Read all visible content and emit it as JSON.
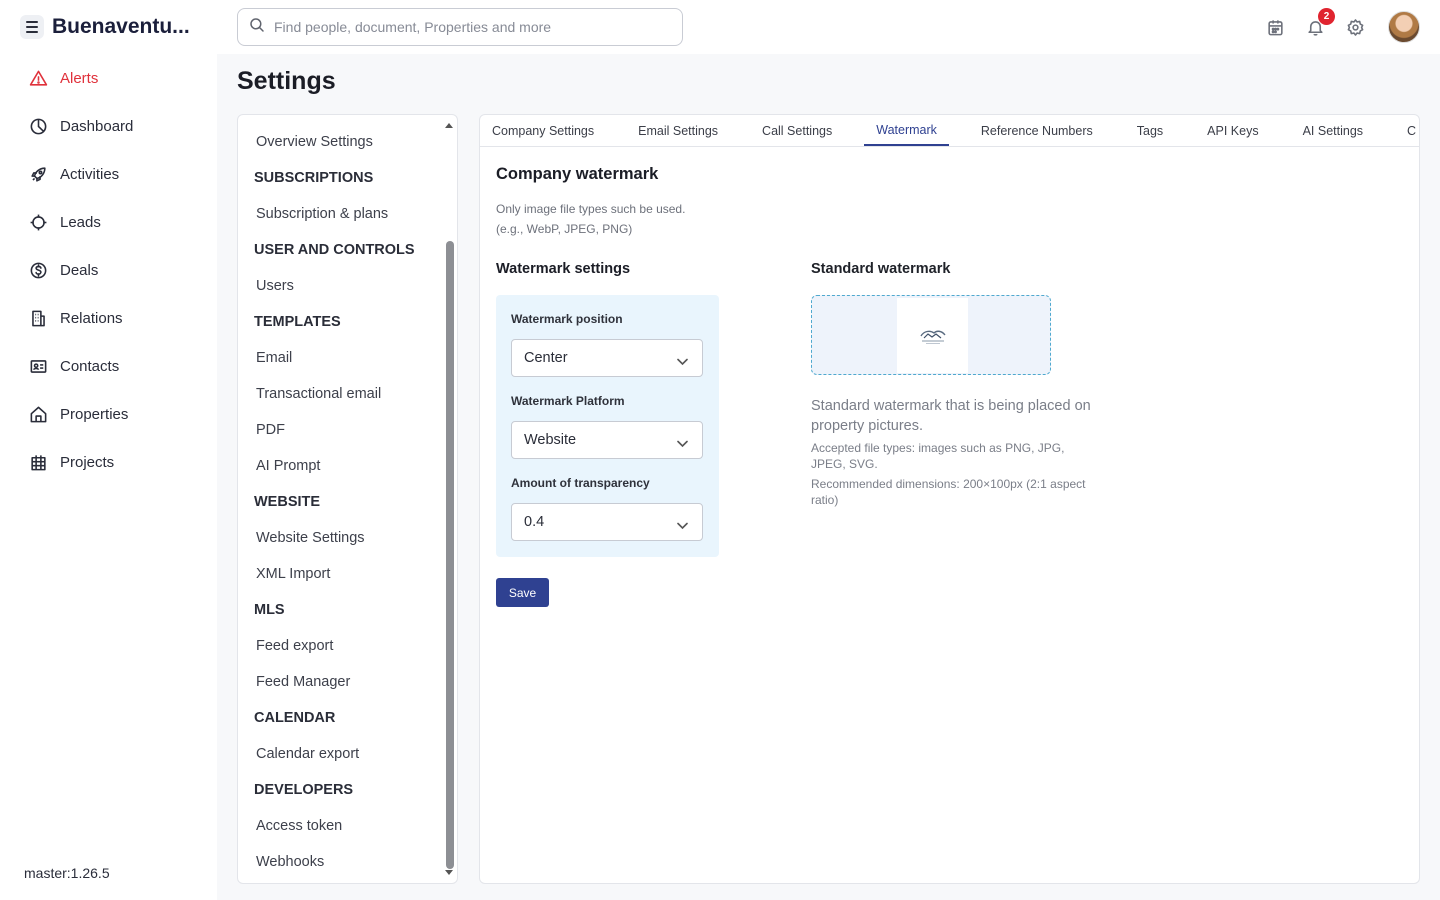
{
  "app": {
    "brand": "Buenaventu...",
    "version": "master:1.26.5"
  },
  "nav": [
    {
      "label": "Alerts",
      "icon": "alert-triangle-icon"
    },
    {
      "label": "Dashboard",
      "icon": "pie-chart-icon"
    },
    {
      "label": "Activities",
      "icon": "rocket-icon"
    },
    {
      "label": "Leads",
      "icon": "target-icon"
    },
    {
      "label": "Deals",
      "icon": "dollar-circle-icon"
    },
    {
      "label": "Relations",
      "icon": "building-icon"
    },
    {
      "label": "Contacts",
      "icon": "contact-card-icon"
    },
    {
      "label": "Properties",
      "icon": "home-icon"
    },
    {
      "label": "Projects",
      "icon": "city-icon"
    }
  ],
  "search": {
    "placeholder": "Find people, document, Properties and more"
  },
  "topbar": {
    "notification_count": "2"
  },
  "page": {
    "title": "Settings"
  },
  "settings_nav": {
    "overview": "Overview Settings",
    "subscriptions_head": "SUBSCRIPTIONS",
    "subscription_plans": "Subscription & plans",
    "user_head": "USER AND CONTROLS",
    "users": "Users",
    "templates_head": "TEMPLATES",
    "email": "Email",
    "transactional": "Transactional email",
    "pdf": "PDF",
    "ai_prompt": "AI Prompt",
    "website_head": "WEBSITE",
    "website_settings": "Website Settings",
    "xml_import": "XML Import",
    "mls_head": "MLS",
    "feed_export": "Feed export",
    "feed_manager": "Feed Manager",
    "calendar_head": "CALENDAR",
    "calendar_export": "Calendar export",
    "developers_head": "DEVELOPERS",
    "access_token": "Access token",
    "webhooks": "Webhooks"
  },
  "tabs": [
    "Company Settings",
    "Email Settings",
    "Call Settings",
    "Watermark",
    "Reference Numbers",
    "Tags",
    "API Keys",
    "AI Settings",
    "C"
  ],
  "watermark": {
    "title": "Company watermark",
    "desc_line1": "Only image file types such be used.",
    "desc_line2": "(e.g., WebP, JPEG, PNG)",
    "settings_title": "Watermark settings",
    "position_label": "Watermark position",
    "position_value": "Center",
    "platform_label": "Watermark Platform",
    "platform_value": "Website",
    "transparency_label": "Amount of transparency",
    "transparency_value": "0.4",
    "save_label": "Save",
    "standard_title": "Standard watermark",
    "standard_desc": "Standard watermark that is being placed on property pictures.",
    "accepted_types": "Accepted file types: images such as PNG, JPG, JPEG, SVG.",
    "recommended_dims": "Recommended dimensions: 200×100px (2:1 aspect ratio)"
  },
  "colors": {
    "accent": "#2f4191",
    "alert": "#e0313b",
    "panel_bg": "#e9f5fd",
    "dropzone_border": "#4fa9cf"
  }
}
